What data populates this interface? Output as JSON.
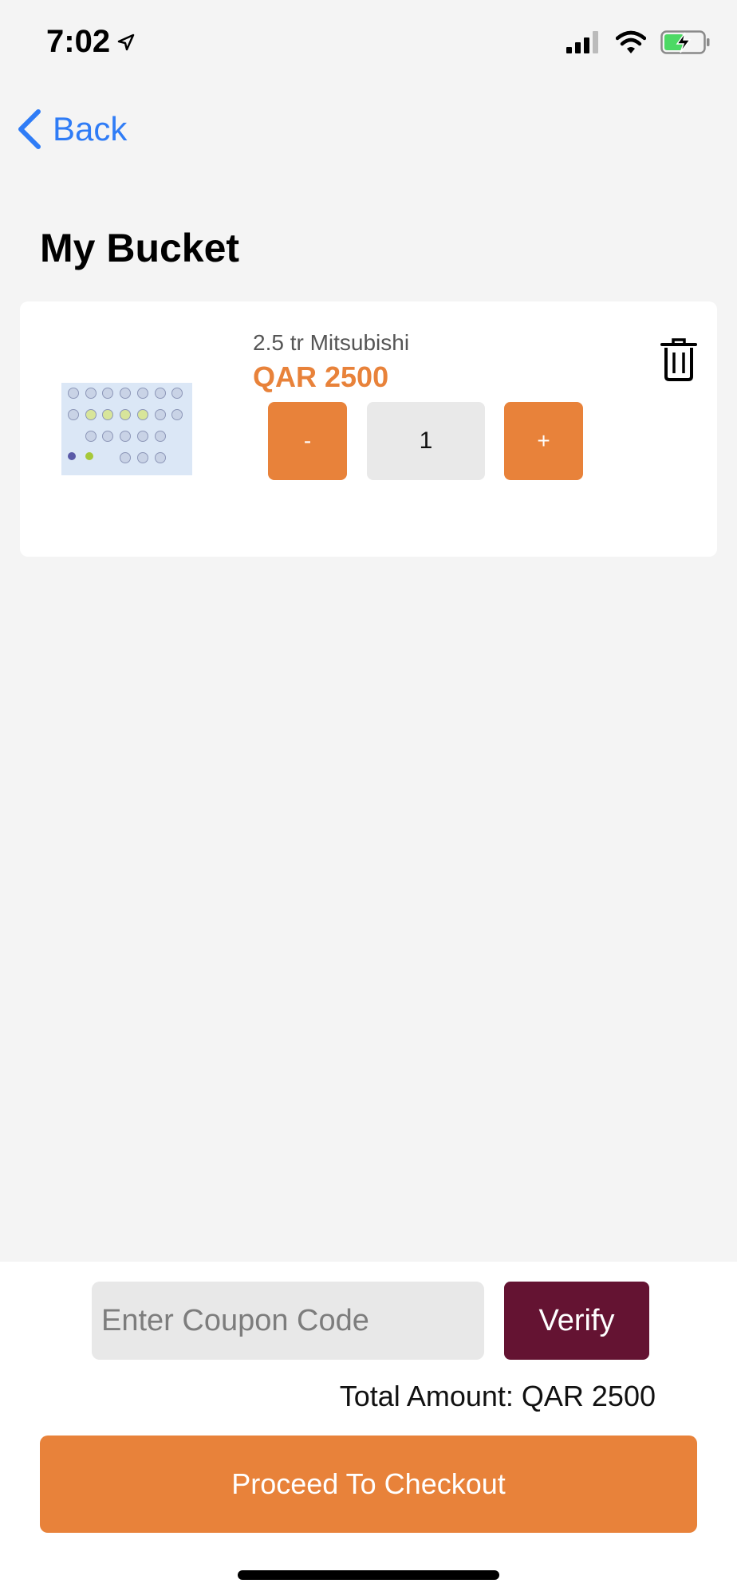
{
  "status_bar": {
    "time": "7:02"
  },
  "nav": {
    "back_label": "Back"
  },
  "page": {
    "title": "My Bucket"
  },
  "cart": {
    "items": [
      {
        "name": "2.5 tr Mitsubishi",
        "price": "QAR 2500",
        "quantity": "1",
        "minus_label": "-",
        "plus_label": "+"
      }
    ]
  },
  "coupon": {
    "placeholder": "Enter Coupon Code",
    "verify_label": "Verify"
  },
  "summary": {
    "total": "Total Amount: QAR 2500"
  },
  "checkout": {
    "label": "Proceed To Checkout"
  },
  "colors": {
    "accent": "#e8823a",
    "link": "#2f7cf6",
    "verify": "#641332"
  }
}
